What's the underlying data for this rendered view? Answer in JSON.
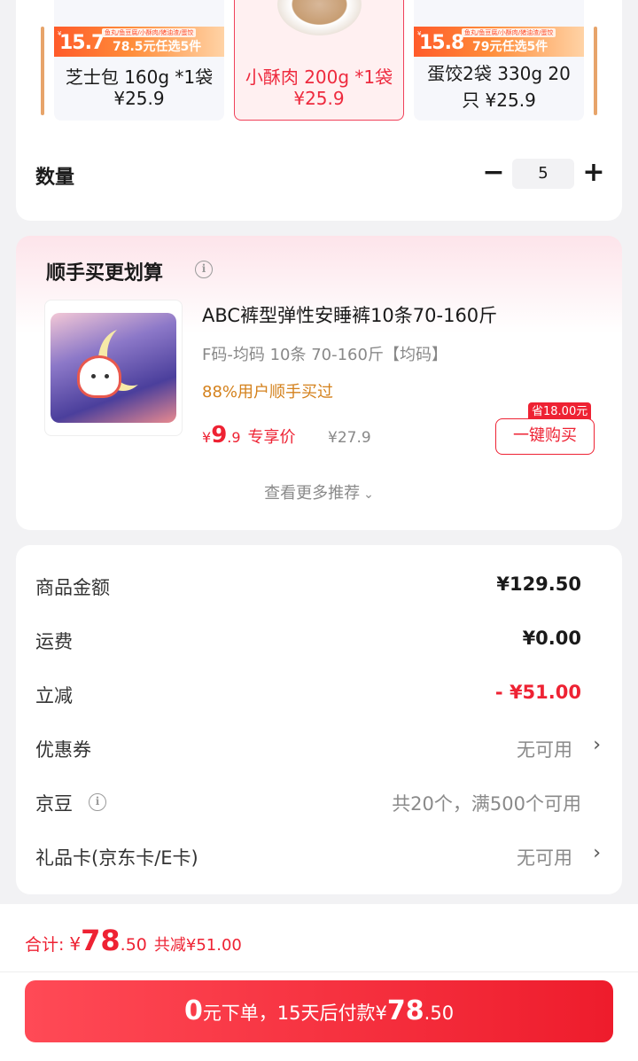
{
  "variants": [
    {
      "name": "芝士包 160g *1袋",
      "price": "¥25.9",
      "banner_price": "15.7",
      "banner_unit": "起",
      "banner_deal": "78.5元任选5件",
      "banner_top": "鱼丸/鱼豆腐/小酥肉/猪油渣/蛋饺"
    },
    {
      "name": "小酥肉 200g *1袋",
      "price": "¥25.9",
      "selected": true
    },
    {
      "name_line1": "蛋饺2袋 330g 20",
      "name_line2": "只 ¥25.9",
      "banner_price": "15.8",
      "banner_unit": "起",
      "banner_deal": "79元任选5件",
      "banner_top": "鱼丸/鱼豆腐/小酥肉/猪油渣/蛋饺"
    }
  ],
  "quantity": {
    "label": "数量",
    "value": "5",
    "minus": "−",
    "plus": "+"
  },
  "recommend": {
    "title": "顺手买更划算",
    "product_name": "ABC裤型弹性安睡裤10条70-160斤",
    "spec": "F码-均码 10条 70-160斤【均码】",
    "users": "88%用户顺手买过",
    "price_symbol": "¥",
    "price_int": "9",
    "price_dec": ".9",
    "price_label": "专享价",
    "original_price": "¥27.9",
    "save_badge": "省18.00元",
    "buy_button": "一键购买",
    "more": "查看更多推荐"
  },
  "summary": {
    "rows": [
      {
        "label": "商品金额",
        "value": "¥129.50"
      },
      {
        "label": "运费",
        "value": "¥0.00"
      },
      {
        "label": "立减",
        "value": "- ¥51.00"
      },
      {
        "label": "优惠券",
        "value": "无可用"
      },
      {
        "label": "京豆",
        "value": "共20个，满500个可用"
      },
      {
        "label": "礼品卡(京东卡/E卡)",
        "value": "无可用"
      }
    ]
  },
  "bottom": {
    "total_label": "合计:",
    "total_symbol": "¥",
    "total_int": "78",
    "total_dec": ".50",
    "total_discount": "共减¥51.00",
    "pay_zero": "0",
    "pay_text": "元下单，15天后付款¥",
    "pay_int": "78",
    "pay_dec": ".50"
  },
  "colors": {
    "accent": "#ee2233",
    "orange": "#d4811c"
  }
}
